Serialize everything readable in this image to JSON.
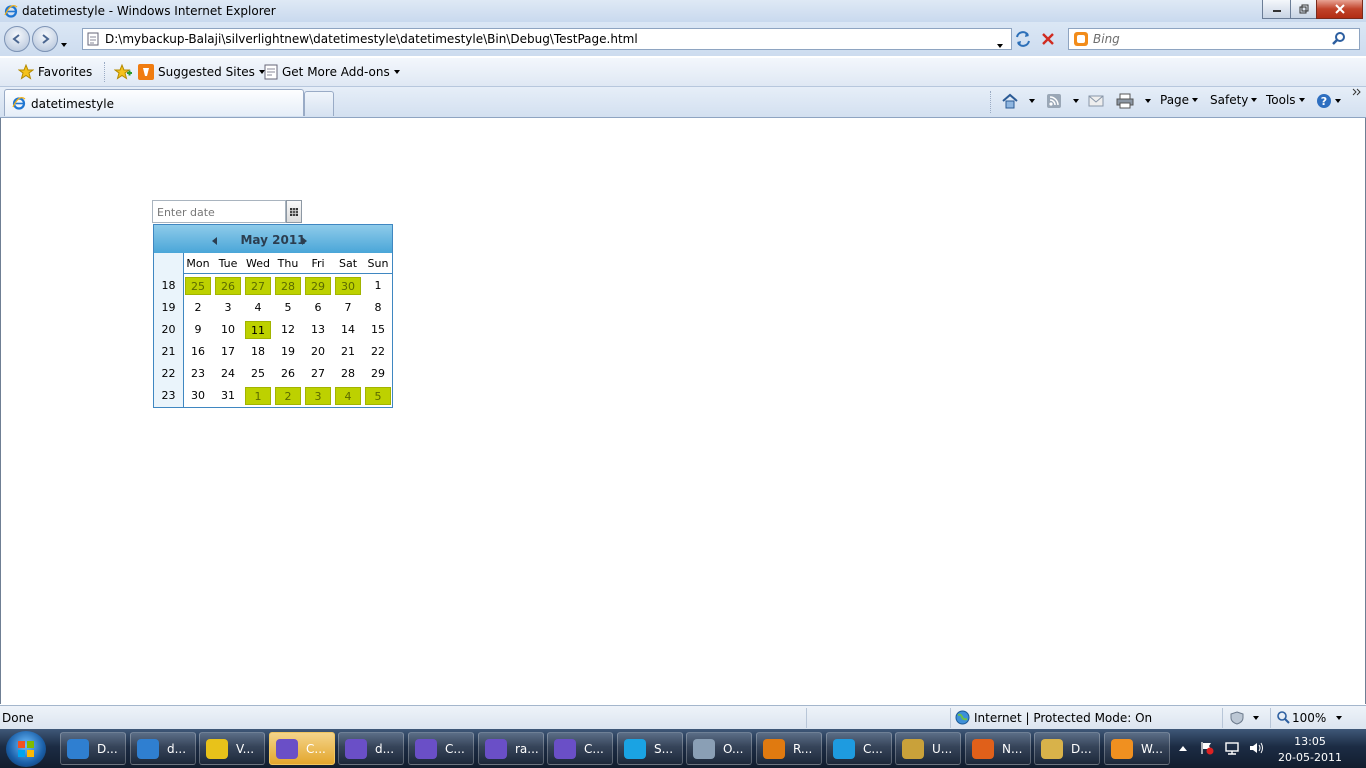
{
  "window": {
    "title": "datetimestyle - Windows Internet Explorer",
    "controls": [
      "minimize",
      "maximize",
      "close"
    ]
  },
  "address_bar": {
    "url": "D:\\mybackup-Balaji\\silverlightnew\\datetimestyle\\datetimestyle\\Bin\\Debug\\TestPage.html",
    "search_placeholder": "Bing"
  },
  "favorites_bar": {
    "favorites_label": "Favorites",
    "items": [
      {
        "label": "Suggested Sites"
      },
      {
        "label": "Get More Add-ons"
      }
    ]
  },
  "tabs": [
    {
      "label": "datetimestyle",
      "active": true
    }
  ],
  "command_bar": {
    "page": "Page",
    "safety": "Safety",
    "tools": "Tools"
  },
  "datepicker": {
    "placeholder": "Enter date",
    "calendar": {
      "month_label": "May 2011",
      "day_headers": [
        "Mon",
        "Tue",
        "Wed",
        "Thu",
        "Fri",
        "Sat",
        "Sun"
      ],
      "weeks": [
        {
          "num": "18",
          "days": [
            {
              "d": "25",
              "hl": true
            },
            {
              "d": "26",
              "hl": true
            },
            {
              "d": "27",
              "hl": true
            },
            {
              "d": "28",
              "hl": true
            },
            {
              "d": "29",
              "hl": true
            },
            {
              "d": "30",
              "hl": true
            },
            {
              "d": "1",
              "hl": false
            }
          ]
        },
        {
          "num": "19",
          "days": [
            {
              "d": "2",
              "hl": false
            },
            {
              "d": "3",
              "hl": false
            },
            {
              "d": "4",
              "hl": false
            },
            {
              "d": "5",
              "hl": false
            },
            {
              "d": "6",
              "hl": false
            },
            {
              "d": "7",
              "hl": false
            },
            {
              "d": "8",
              "hl": false
            }
          ]
        },
        {
          "num": "20",
          "days": [
            {
              "d": "9",
              "hl": false
            },
            {
              "d": "10",
              "hl": false
            },
            {
              "d": "11",
              "hl": true
            },
            {
              "d": "12",
              "hl": false
            },
            {
              "d": "13",
              "hl": false
            },
            {
              "d": "14",
              "hl": false
            },
            {
              "d": "15",
              "hl": false
            }
          ]
        },
        {
          "num": "21",
          "days": [
            {
              "d": "16",
              "hl": false
            },
            {
              "d": "17",
              "hl": false
            },
            {
              "d": "18",
              "hl": false
            },
            {
              "d": "19",
              "hl": false
            },
            {
              "d": "20",
              "hl": false
            },
            {
              "d": "21",
              "hl": false
            },
            {
              "d": "22",
              "hl": false
            }
          ]
        },
        {
          "num": "22",
          "days": [
            {
              "d": "23",
              "hl": false
            },
            {
              "d": "24",
              "hl": false
            },
            {
              "d": "25",
              "hl": false
            },
            {
              "d": "26",
              "hl": false
            },
            {
              "d": "27",
              "hl": false
            },
            {
              "d": "28",
              "hl": false
            },
            {
              "d": "29",
              "hl": false
            }
          ]
        },
        {
          "num": "23",
          "days": [
            {
              "d": "30",
              "hl": false
            },
            {
              "d": "31",
              "hl": false
            },
            {
              "d": "1",
              "hl": true
            },
            {
              "d": "2",
              "hl": true
            },
            {
              "d": "3",
              "hl": true
            },
            {
              "d": "4",
              "hl": true
            },
            {
              "d": "5",
              "hl": true
            }
          ]
        }
      ]
    }
  },
  "status_bar": {
    "status": "Done",
    "zone": "Internet | Protected Mode: On",
    "zoom": "100%"
  },
  "taskbar": {
    "buttons": [
      {
        "label": "D...",
        "color": "#2f7fd1",
        "active": false
      },
      {
        "label": "d...",
        "color": "#2f7fd1",
        "active": false
      },
      {
        "label": "V...",
        "color": "#e8c21a",
        "active": false
      },
      {
        "label": "C...",
        "color": "#6a4fc7",
        "active": true
      },
      {
        "label": "d...",
        "color": "#6a4fc7",
        "active": false
      },
      {
        "label": "C...",
        "color": "#6a4fc7",
        "active": false
      },
      {
        "label": "ra...",
        "color": "#6a4fc7",
        "active": false
      },
      {
        "label": "C...",
        "color": "#6a4fc7",
        "active": false
      },
      {
        "label": "S...",
        "color": "#1aa3e3",
        "active": false
      },
      {
        "label": "O...",
        "color": "#8a9fb5",
        "active": false
      },
      {
        "label": "R...",
        "color": "#e07a10",
        "active": false
      },
      {
        "label": "C...",
        "color": "#1e9be0",
        "active": false
      },
      {
        "label": "U...",
        "color": "#c9a13a",
        "active": false
      },
      {
        "label": "N...",
        "color": "#e0601a",
        "active": false
      },
      {
        "label": "D...",
        "color": "#d8b24a",
        "active": false
      },
      {
        "label": "W...",
        "color": "#f09020",
        "active": false
      }
    ],
    "clock_time": "13:05",
    "clock_date": "20-05-2011"
  }
}
